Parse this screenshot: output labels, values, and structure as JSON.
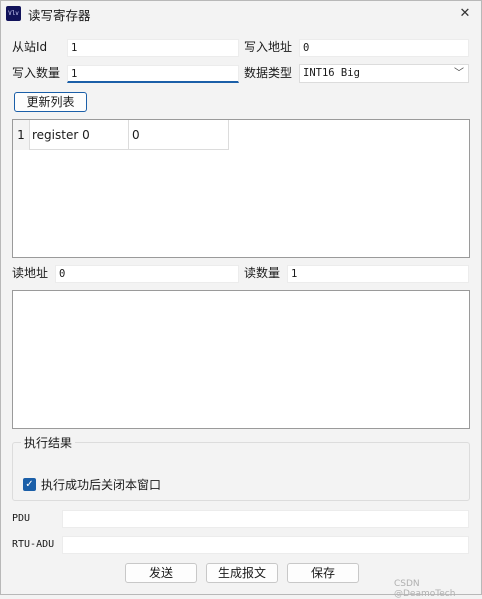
{
  "window": {
    "title": "读写寄存器",
    "icon_text": "Vlv",
    "close_glyph": "✕"
  },
  "slave_id": {
    "label": "从站Id",
    "value": "1"
  },
  "write_address": {
    "label": "写入地址",
    "value": "0"
  },
  "write_count": {
    "label": "写入数量",
    "value": "1"
  },
  "data_type": {
    "label": "数据类型",
    "selected": "INT16 Big",
    "arrow_glyph": "﹀"
  },
  "refresh_button": "更新列表",
  "write_table": {
    "rows": [
      {
        "index": "1",
        "name": "register 0",
        "value": "0"
      }
    ]
  },
  "read_address": {
    "label": "读地址",
    "value": "0"
  },
  "read_count": {
    "label": "读数量",
    "value": "1"
  },
  "result_group": {
    "title": "执行结果",
    "checkbox_label": "执行成功后关闭本窗口",
    "checkbox_checked": true,
    "check_glyph": "✓"
  },
  "pdu": {
    "label": "PDU",
    "value": ""
  },
  "rtu_adu": {
    "label": "RTU-ADU",
    "value": ""
  },
  "buttons": {
    "send": "发送",
    "generate": "生成报文",
    "save": "保存"
  },
  "watermark": "CSDN @DeamoTech"
}
